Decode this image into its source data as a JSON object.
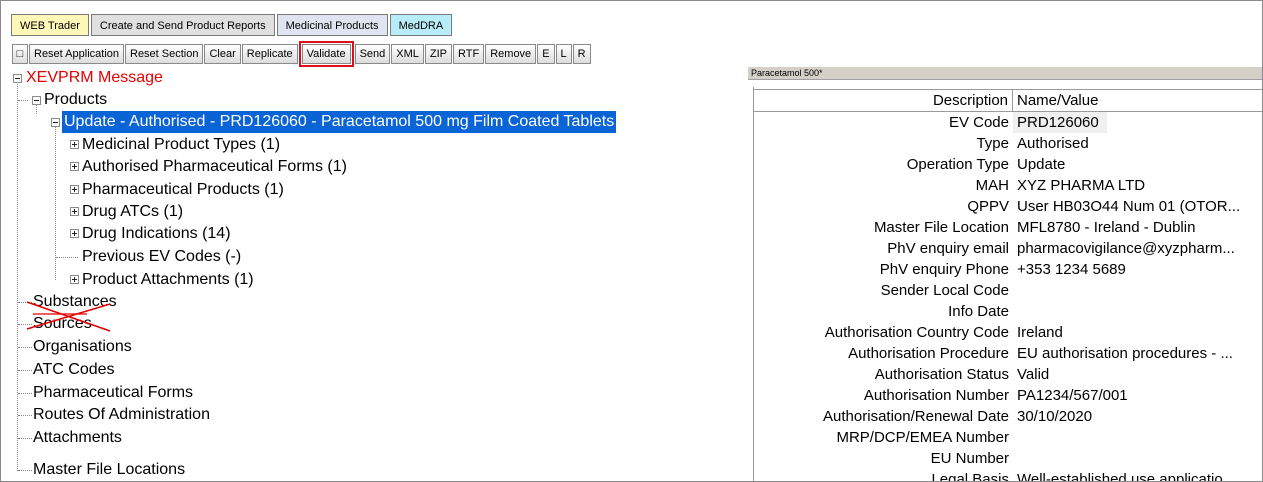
{
  "tabs": [
    {
      "label": "WEB Trader",
      "color": "#fff8b8"
    },
    {
      "label": "Create and Send Product Reports",
      "color": "#e0e0e0"
    },
    {
      "label": "Medicinal Products",
      "color": "#e0e4f0"
    },
    {
      "label": "MedDRA",
      "color": "#b8ecf8"
    }
  ],
  "toolbar": {
    "buttons": [
      "□",
      "Reset Application",
      "Reset Section",
      "Clear",
      "Replicate",
      "Validate",
      "Send",
      "XML",
      "ZIP",
      "RTF",
      "Remove",
      "E",
      "L",
      "R"
    ],
    "highlighted": "Validate"
  },
  "tree": {
    "root": "XEVPRM Message",
    "products": "Products",
    "selected_product": "Update - Authorised - PRD126060 - Paracetamol 500 mg Film Coated Tablets",
    "product_children": [
      "Medicinal Product Types (1)",
      "Authorised Pharmaceutical Forms (1)",
      "Pharmaceutical Products (1)",
      "Drug ATCs (1)",
      "Drug Indications (14)",
      "Previous EV Codes (-)",
      "Product Attachments (1)"
    ],
    "struck_out": [
      "Substances",
      "Sources"
    ],
    "other_sections": [
      "Organisations",
      "ATC Codes",
      "Pharmaceutical Forms",
      "Routes Of Administration",
      "Attachments",
      "Master File Locations"
    ]
  },
  "panel": {
    "title": "Paracetamol 500*",
    "header_desc": "Description",
    "header_value": "Name/Value",
    "rows": [
      {
        "desc": "EV Code",
        "value": "PRD126060"
      },
      {
        "desc": "Type",
        "value": "Authorised"
      },
      {
        "desc": "Operation Type",
        "value": "Update"
      },
      {
        "desc": "MAH",
        "value": "XYZ PHARMA LTD"
      },
      {
        "desc": "QPPV",
        "value": "User HB03O44 Num 01 (OTOR..."
      },
      {
        "desc": "Master File Location",
        "value": "MFL8780 - Ireland - Dublin"
      },
      {
        "desc": "PhV enquiry email",
        "value": "pharmacovigilance@xyzpharm..."
      },
      {
        "desc": "PhV enquiry Phone",
        "value": "+353 1234 5689"
      },
      {
        "desc": "Sender Local Code",
        "value": ""
      },
      {
        "desc": "Info Date",
        "value": ""
      },
      {
        "desc": "Authorisation Country Code",
        "value": "Ireland"
      },
      {
        "desc": "Authorisation Procedure",
        "value": "EU authorisation procedures  - ..."
      },
      {
        "desc": "Authorisation Status",
        "value": "Valid"
      },
      {
        "desc": "Authorisation Number",
        "value": "PA1234/567/001"
      },
      {
        "desc": "Authorisation/Renewal Date",
        "value": "30/10/2020"
      },
      {
        "desc": "MRP/DCP/EMEA Number",
        "value": ""
      },
      {
        "desc": "EU Number",
        "value": ""
      },
      {
        "desc": "Legal Basis",
        "value": "Well-established use applicatio..."
      }
    ]
  }
}
